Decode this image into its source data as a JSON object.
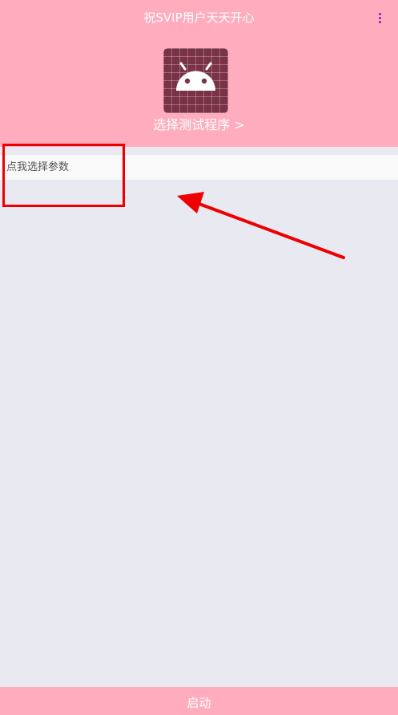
{
  "header": {
    "title": "祝SVIP用户天天开心",
    "menu_icon": "more-vert-icon",
    "app_icon": "android-icon",
    "choose_program_label": "选择测试程序 >"
  },
  "params": {
    "label": "点我选择参数"
  },
  "footer": {
    "start_label": "启动"
  },
  "colors": {
    "header_bg": "#ffadbe",
    "page_bg": "#e9e9f1",
    "annotation": "#ee0000",
    "menu_dots": "#7b2cc4"
  }
}
